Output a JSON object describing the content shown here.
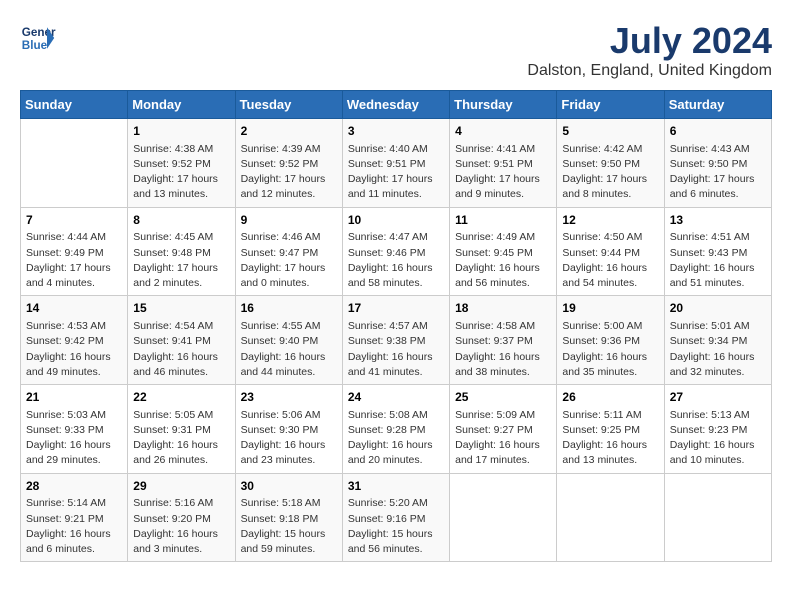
{
  "header": {
    "logo_line1": "General",
    "logo_line2": "Blue",
    "month_title": "July 2024",
    "location": "Dalston, England, United Kingdom"
  },
  "days_of_week": [
    "Sunday",
    "Monday",
    "Tuesday",
    "Wednesday",
    "Thursday",
    "Friday",
    "Saturday"
  ],
  "weeks": [
    [
      {
        "day": "",
        "info": ""
      },
      {
        "day": "1",
        "info": "Sunrise: 4:38 AM\nSunset: 9:52 PM\nDaylight: 17 hours\nand 13 minutes."
      },
      {
        "day": "2",
        "info": "Sunrise: 4:39 AM\nSunset: 9:52 PM\nDaylight: 17 hours\nand 12 minutes."
      },
      {
        "day": "3",
        "info": "Sunrise: 4:40 AM\nSunset: 9:51 PM\nDaylight: 17 hours\nand 11 minutes."
      },
      {
        "day": "4",
        "info": "Sunrise: 4:41 AM\nSunset: 9:51 PM\nDaylight: 17 hours\nand 9 minutes."
      },
      {
        "day": "5",
        "info": "Sunrise: 4:42 AM\nSunset: 9:50 PM\nDaylight: 17 hours\nand 8 minutes."
      },
      {
        "day": "6",
        "info": "Sunrise: 4:43 AM\nSunset: 9:50 PM\nDaylight: 17 hours\nand 6 minutes."
      }
    ],
    [
      {
        "day": "7",
        "info": "Sunrise: 4:44 AM\nSunset: 9:49 PM\nDaylight: 17 hours\nand 4 minutes."
      },
      {
        "day": "8",
        "info": "Sunrise: 4:45 AM\nSunset: 9:48 PM\nDaylight: 17 hours\nand 2 minutes."
      },
      {
        "day": "9",
        "info": "Sunrise: 4:46 AM\nSunset: 9:47 PM\nDaylight: 17 hours\nand 0 minutes."
      },
      {
        "day": "10",
        "info": "Sunrise: 4:47 AM\nSunset: 9:46 PM\nDaylight: 16 hours\nand 58 minutes."
      },
      {
        "day": "11",
        "info": "Sunrise: 4:49 AM\nSunset: 9:45 PM\nDaylight: 16 hours\nand 56 minutes."
      },
      {
        "day": "12",
        "info": "Sunrise: 4:50 AM\nSunset: 9:44 PM\nDaylight: 16 hours\nand 54 minutes."
      },
      {
        "day": "13",
        "info": "Sunrise: 4:51 AM\nSunset: 9:43 PM\nDaylight: 16 hours\nand 51 minutes."
      }
    ],
    [
      {
        "day": "14",
        "info": "Sunrise: 4:53 AM\nSunset: 9:42 PM\nDaylight: 16 hours\nand 49 minutes."
      },
      {
        "day": "15",
        "info": "Sunrise: 4:54 AM\nSunset: 9:41 PM\nDaylight: 16 hours\nand 46 minutes."
      },
      {
        "day": "16",
        "info": "Sunrise: 4:55 AM\nSunset: 9:40 PM\nDaylight: 16 hours\nand 44 minutes."
      },
      {
        "day": "17",
        "info": "Sunrise: 4:57 AM\nSunset: 9:38 PM\nDaylight: 16 hours\nand 41 minutes."
      },
      {
        "day": "18",
        "info": "Sunrise: 4:58 AM\nSunset: 9:37 PM\nDaylight: 16 hours\nand 38 minutes."
      },
      {
        "day": "19",
        "info": "Sunrise: 5:00 AM\nSunset: 9:36 PM\nDaylight: 16 hours\nand 35 minutes."
      },
      {
        "day": "20",
        "info": "Sunrise: 5:01 AM\nSunset: 9:34 PM\nDaylight: 16 hours\nand 32 minutes."
      }
    ],
    [
      {
        "day": "21",
        "info": "Sunrise: 5:03 AM\nSunset: 9:33 PM\nDaylight: 16 hours\nand 29 minutes."
      },
      {
        "day": "22",
        "info": "Sunrise: 5:05 AM\nSunset: 9:31 PM\nDaylight: 16 hours\nand 26 minutes."
      },
      {
        "day": "23",
        "info": "Sunrise: 5:06 AM\nSunset: 9:30 PM\nDaylight: 16 hours\nand 23 minutes."
      },
      {
        "day": "24",
        "info": "Sunrise: 5:08 AM\nSunset: 9:28 PM\nDaylight: 16 hours\nand 20 minutes."
      },
      {
        "day": "25",
        "info": "Sunrise: 5:09 AM\nSunset: 9:27 PM\nDaylight: 16 hours\nand 17 minutes."
      },
      {
        "day": "26",
        "info": "Sunrise: 5:11 AM\nSunset: 9:25 PM\nDaylight: 16 hours\nand 13 minutes."
      },
      {
        "day": "27",
        "info": "Sunrise: 5:13 AM\nSunset: 9:23 PM\nDaylight: 16 hours\nand 10 minutes."
      }
    ],
    [
      {
        "day": "28",
        "info": "Sunrise: 5:14 AM\nSunset: 9:21 PM\nDaylight: 16 hours\nand 6 minutes."
      },
      {
        "day": "29",
        "info": "Sunrise: 5:16 AM\nSunset: 9:20 PM\nDaylight: 16 hours\nand 3 minutes."
      },
      {
        "day": "30",
        "info": "Sunrise: 5:18 AM\nSunset: 9:18 PM\nDaylight: 15 hours\nand 59 minutes."
      },
      {
        "day": "31",
        "info": "Sunrise: 5:20 AM\nSunset: 9:16 PM\nDaylight: 15 hours\nand 56 minutes."
      },
      {
        "day": "",
        "info": ""
      },
      {
        "day": "",
        "info": ""
      },
      {
        "day": "",
        "info": ""
      }
    ]
  ]
}
